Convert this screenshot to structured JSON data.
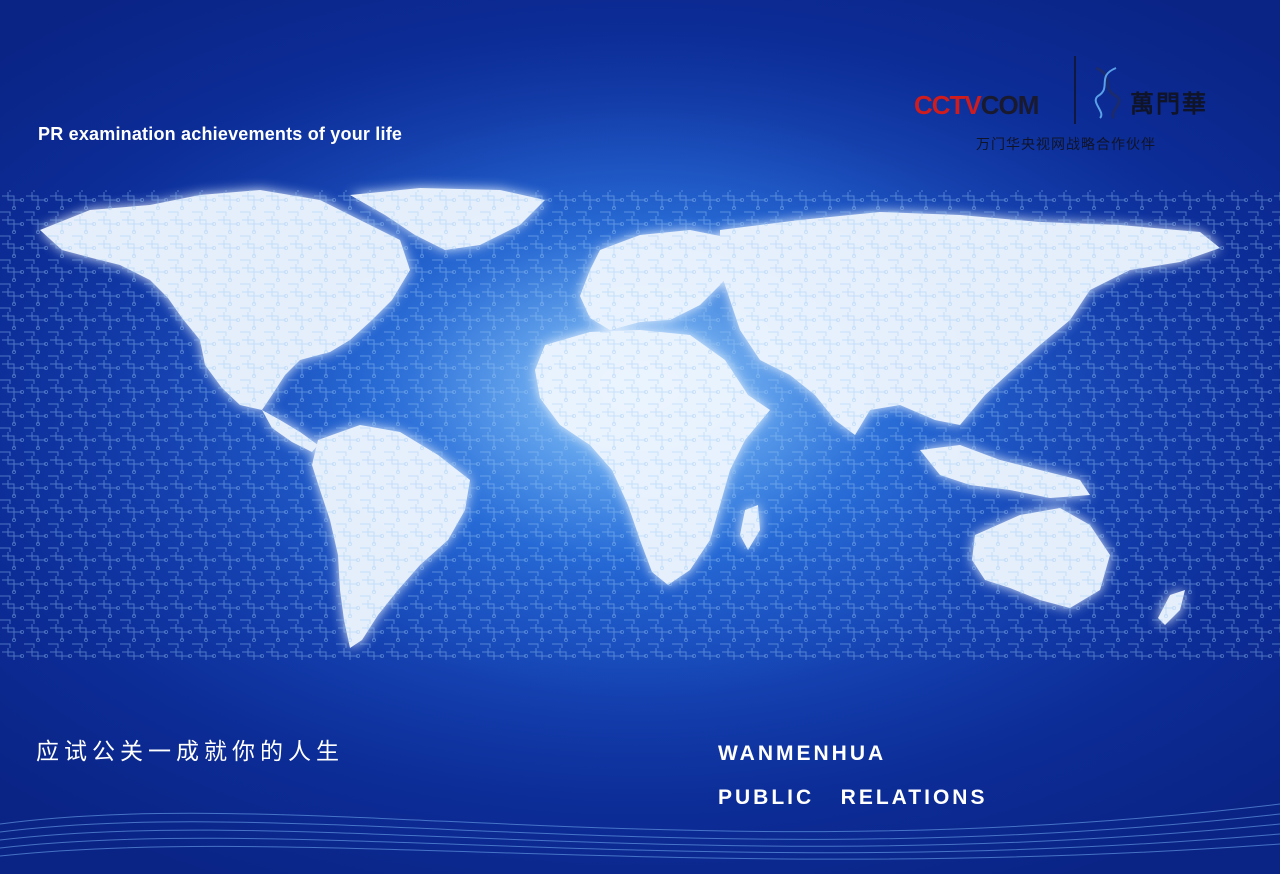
{
  "tagline": "PR examination achievements of your life",
  "slogan_cn": "应试公关一成就你的人生",
  "brand": {
    "line1": "WANMENHUA",
    "line2": "PUBLIC   RELATIONS"
  },
  "logo": {
    "cctv_text": "CCTV",
    "cctv_suffix": "COM",
    "wanmenhua_name": "萬門華",
    "partner_text": "万门华央视网战略合作伙伴"
  },
  "colors": {
    "background": "#0c2c96",
    "glow": "#78c8ff",
    "map": "#eaf4ff",
    "cctv_red": "#d01c1c"
  }
}
